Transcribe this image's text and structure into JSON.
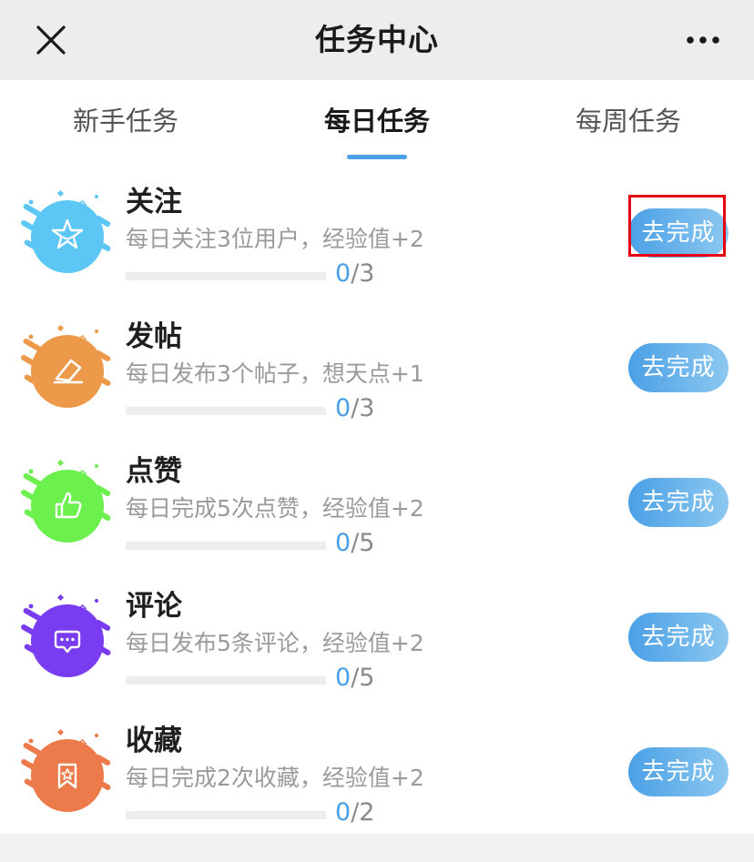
{
  "header": {
    "title": "任务中心",
    "close_icon": "close-icon",
    "more_icon": "more-icon"
  },
  "tabs": [
    {
      "label": "新手任务",
      "active": false
    },
    {
      "label": "每日任务",
      "active": true
    },
    {
      "label": "每周任务",
      "active": false
    }
  ],
  "tasks": [
    {
      "name": "关注",
      "desc": "每日关注3位用户，经验值+2",
      "current": "0",
      "total": "/3",
      "progress": 0,
      "button": "去完成",
      "icon": "star-icon",
      "color": "#5cc6f4",
      "highlighted": true
    },
    {
      "name": "发帖",
      "desc": "每日发布3个帖子，想天点+1",
      "current": "0",
      "total": "/3",
      "progress": 0,
      "button": "去完成",
      "icon": "eraser-icon",
      "color": "#ec9a4a",
      "highlighted": false
    },
    {
      "name": "点赞",
      "desc": "每日完成5次点赞，经验值+2",
      "current": "0",
      "total": "/5",
      "progress": 0,
      "button": "去完成",
      "icon": "thumbs-up-icon",
      "color": "#6cf04e",
      "highlighted": false
    },
    {
      "name": "评论",
      "desc": "每日发布5条评论，经验值+2",
      "current": "0",
      "total": "/5",
      "progress": 0,
      "button": "去完成",
      "icon": "comment-icon",
      "color": "#7a3cf0",
      "highlighted": false
    },
    {
      "name": "收藏",
      "desc": "每日完成2次收藏，经验值+2",
      "current": "0",
      "total": "/2",
      "progress": 0,
      "button": "去完成",
      "icon": "bookmark-icon",
      "color": "#ec7a4a",
      "highlighted": false
    }
  ],
  "colors": {
    "accent": "#4aa0e6",
    "highlight": "#e60012"
  }
}
